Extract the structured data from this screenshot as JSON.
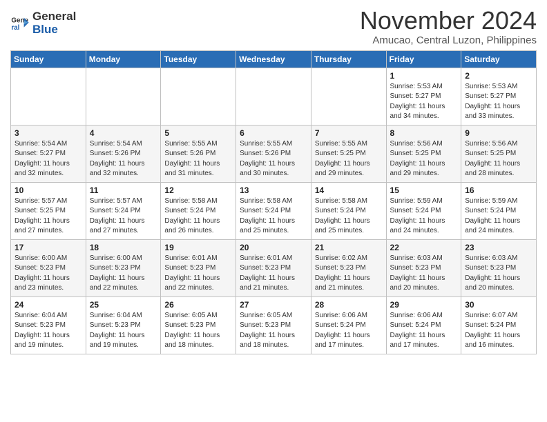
{
  "header": {
    "logo_line1": "General",
    "logo_line2": "Blue",
    "month": "November 2024",
    "location": "Amucao, Central Luzon, Philippines"
  },
  "days_of_week": [
    "Sunday",
    "Monday",
    "Tuesday",
    "Wednesday",
    "Thursday",
    "Friday",
    "Saturday"
  ],
  "weeks": [
    [
      {
        "day": "",
        "info": ""
      },
      {
        "day": "",
        "info": ""
      },
      {
        "day": "",
        "info": ""
      },
      {
        "day": "",
        "info": ""
      },
      {
        "day": "",
        "info": ""
      },
      {
        "day": "1",
        "info": "Sunrise: 5:53 AM\nSunset: 5:27 PM\nDaylight: 11 hours\nand 34 minutes."
      },
      {
        "day": "2",
        "info": "Sunrise: 5:53 AM\nSunset: 5:27 PM\nDaylight: 11 hours\nand 33 minutes."
      }
    ],
    [
      {
        "day": "3",
        "info": "Sunrise: 5:54 AM\nSunset: 5:27 PM\nDaylight: 11 hours\nand 32 minutes."
      },
      {
        "day": "4",
        "info": "Sunrise: 5:54 AM\nSunset: 5:26 PM\nDaylight: 11 hours\nand 32 minutes."
      },
      {
        "day": "5",
        "info": "Sunrise: 5:55 AM\nSunset: 5:26 PM\nDaylight: 11 hours\nand 31 minutes."
      },
      {
        "day": "6",
        "info": "Sunrise: 5:55 AM\nSunset: 5:26 PM\nDaylight: 11 hours\nand 30 minutes."
      },
      {
        "day": "7",
        "info": "Sunrise: 5:55 AM\nSunset: 5:25 PM\nDaylight: 11 hours\nand 29 minutes."
      },
      {
        "day": "8",
        "info": "Sunrise: 5:56 AM\nSunset: 5:25 PM\nDaylight: 11 hours\nand 29 minutes."
      },
      {
        "day": "9",
        "info": "Sunrise: 5:56 AM\nSunset: 5:25 PM\nDaylight: 11 hours\nand 28 minutes."
      }
    ],
    [
      {
        "day": "10",
        "info": "Sunrise: 5:57 AM\nSunset: 5:25 PM\nDaylight: 11 hours\nand 27 minutes."
      },
      {
        "day": "11",
        "info": "Sunrise: 5:57 AM\nSunset: 5:24 PM\nDaylight: 11 hours\nand 27 minutes."
      },
      {
        "day": "12",
        "info": "Sunrise: 5:58 AM\nSunset: 5:24 PM\nDaylight: 11 hours\nand 26 minutes."
      },
      {
        "day": "13",
        "info": "Sunrise: 5:58 AM\nSunset: 5:24 PM\nDaylight: 11 hours\nand 25 minutes."
      },
      {
        "day": "14",
        "info": "Sunrise: 5:58 AM\nSunset: 5:24 PM\nDaylight: 11 hours\nand 25 minutes."
      },
      {
        "day": "15",
        "info": "Sunrise: 5:59 AM\nSunset: 5:24 PM\nDaylight: 11 hours\nand 24 minutes."
      },
      {
        "day": "16",
        "info": "Sunrise: 5:59 AM\nSunset: 5:24 PM\nDaylight: 11 hours\nand 24 minutes."
      }
    ],
    [
      {
        "day": "17",
        "info": "Sunrise: 6:00 AM\nSunset: 5:23 PM\nDaylight: 11 hours\nand 23 minutes."
      },
      {
        "day": "18",
        "info": "Sunrise: 6:00 AM\nSunset: 5:23 PM\nDaylight: 11 hours\nand 22 minutes."
      },
      {
        "day": "19",
        "info": "Sunrise: 6:01 AM\nSunset: 5:23 PM\nDaylight: 11 hours\nand 22 minutes."
      },
      {
        "day": "20",
        "info": "Sunrise: 6:01 AM\nSunset: 5:23 PM\nDaylight: 11 hours\nand 21 minutes."
      },
      {
        "day": "21",
        "info": "Sunrise: 6:02 AM\nSunset: 5:23 PM\nDaylight: 11 hours\nand 21 minutes."
      },
      {
        "day": "22",
        "info": "Sunrise: 6:03 AM\nSunset: 5:23 PM\nDaylight: 11 hours\nand 20 minutes."
      },
      {
        "day": "23",
        "info": "Sunrise: 6:03 AM\nSunset: 5:23 PM\nDaylight: 11 hours\nand 20 minutes."
      }
    ],
    [
      {
        "day": "24",
        "info": "Sunrise: 6:04 AM\nSunset: 5:23 PM\nDaylight: 11 hours\nand 19 minutes."
      },
      {
        "day": "25",
        "info": "Sunrise: 6:04 AM\nSunset: 5:23 PM\nDaylight: 11 hours\nand 19 minutes."
      },
      {
        "day": "26",
        "info": "Sunrise: 6:05 AM\nSunset: 5:23 PM\nDaylight: 11 hours\nand 18 minutes."
      },
      {
        "day": "27",
        "info": "Sunrise: 6:05 AM\nSunset: 5:23 PM\nDaylight: 11 hours\nand 18 minutes."
      },
      {
        "day": "28",
        "info": "Sunrise: 6:06 AM\nSunset: 5:24 PM\nDaylight: 11 hours\nand 17 minutes."
      },
      {
        "day": "29",
        "info": "Sunrise: 6:06 AM\nSunset: 5:24 PM\nDaylight: 11 hours\nand 17 minutes."
      },
      {
        "day": "30",
        "info": "Sunrise: 6:07 AM\nSunset: 5:24 PM\nDaylight: 11 hours\nand 16 minutes."
      }
    ]
  ]
}
